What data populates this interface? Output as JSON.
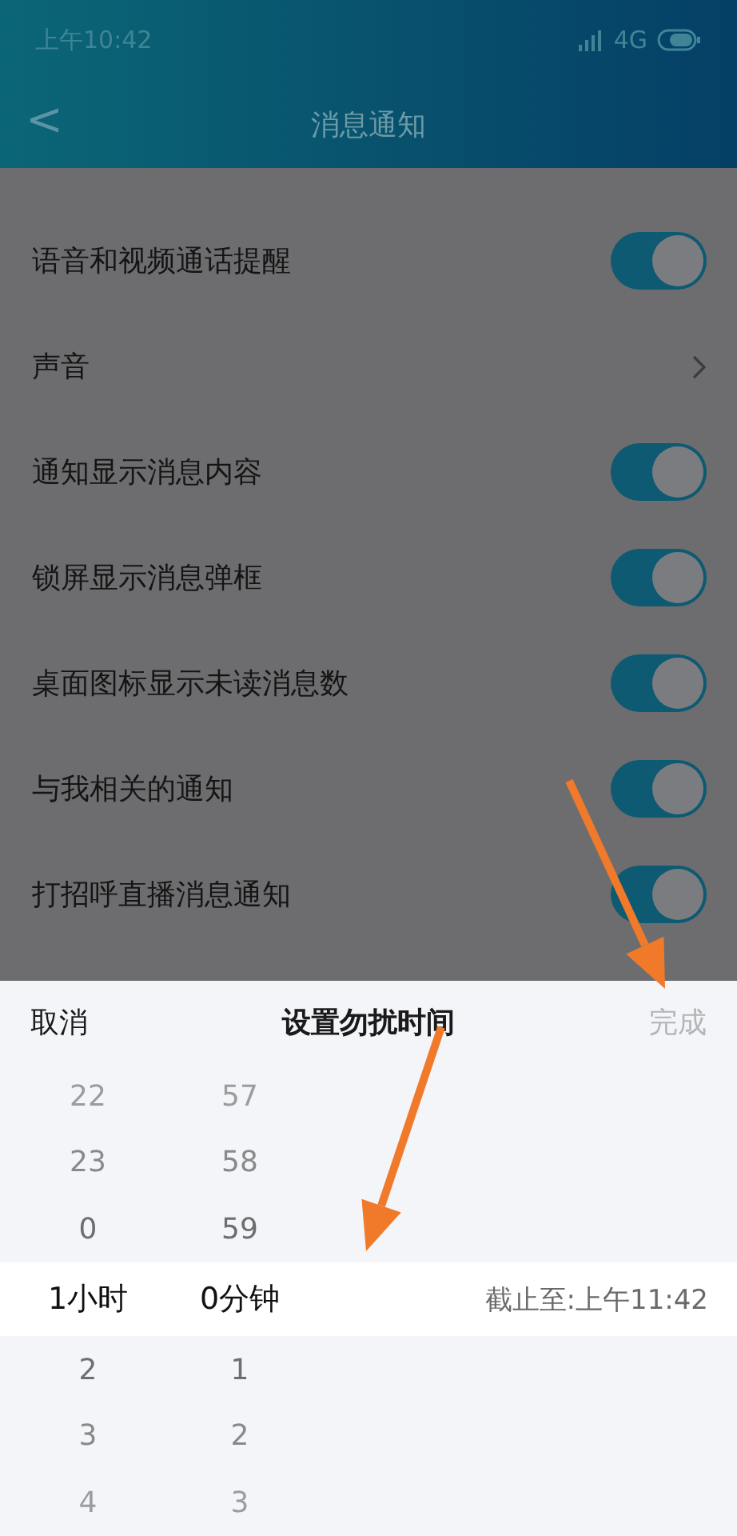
{
  "status_bar": {
    "time": "上午10:42",
    "network": "4G"
  },
  "nav": {
    "back": "<",
    "title": "消息通知"
  },
  "settings": [
    {
      "label": "语音和视频通话提醒",
      "kind": "toggle",
      "on": true
    },
    {
      "label": "声音",
      "kind": "link"
    },
    {
      "label": "通知显示消息内容",
      "kind": "toggle",
      "on": true
    },
    {
      "label": "锁屏显示消息弹框",
      "kind": "toggle",
      "on": true
    },
    {
      "label": "桌面图标显示未读消息数",
      "kind": "toggle",
      "on": true
    },
    {
      "label": "与我相关的通知",
      "kind": "toggle",
      "on": true
    },
    {
      "label": "打招呼直播消息通知",
      "kind": "toggle",
      "on": true
    }
  ],
  "sheet": {
    "cancel": "取消",
    "title": "设置勿扰时间",
    "done": "完成",
    "until": "截止至:上午11:42",
    "rows": [
      {
        "hour": "22",
        "minute": "57",
        "selected": false
      },
      {
        "hour": "23",
        "minute": "58",
        "selected": false
      },
      {
        "hour": "0",
        "minute": "59",
        "selected": false
      },
      {
        "hour": "1小时",
        "minute": "0分钟",
        "selected": true
      },
      {
        "hour": "2",
        "minute": "1",
        "selected": false
      },
      {
        "hour": "3",
        "minute": "2",
        "selected": false
      },
      {
        "hour": "4",
        "minute": "3",
        "selected": false
      }
    ]
  }
}
